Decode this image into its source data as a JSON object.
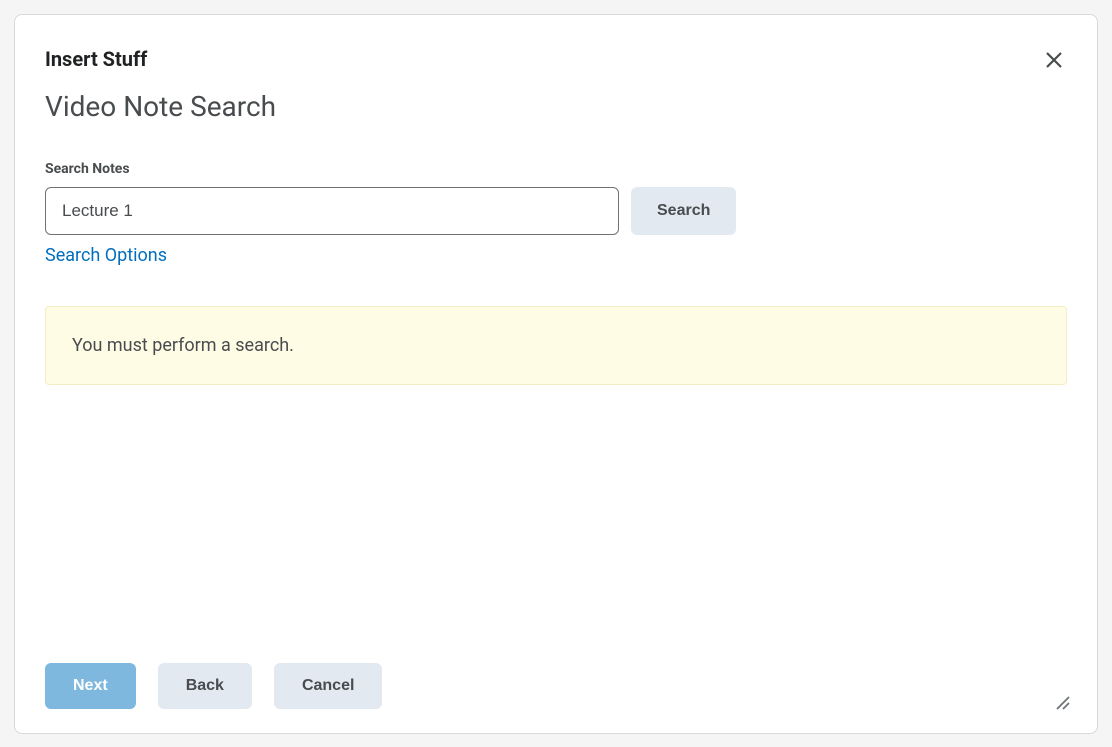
{
  "dialog": {
    "title": "Insert Stuff",
    "pageTitle": "Video Note Search"
  },
  "search": {
    "label": "Search Notes",
    "value": "Lecture 1",
    "buttonLabel": "Search",
    "optionsLink": "Search Options"
  },
  "alert": {
    "message": "You must perform a search."
  },
  "footer": {
    "nextLabel": "Next",
    "backLabel": "Back",
    "cancelLabel": "Cancel"
  }
}
